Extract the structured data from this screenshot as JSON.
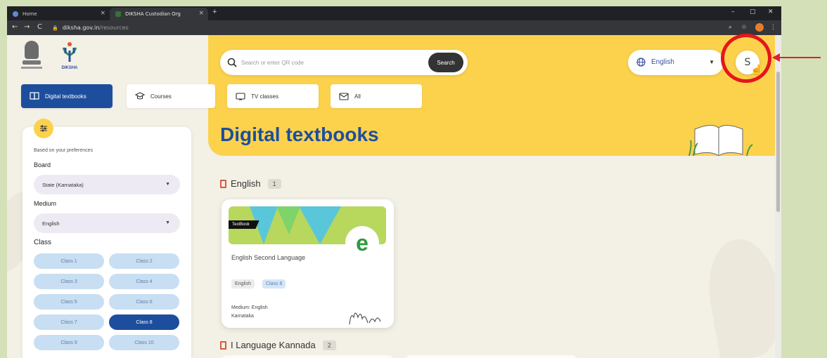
{
  "browser": {
    "tabs": [
      {
        "title": "Home"
      },
      {
        "title": "DIKSHA Custodian Org"
      }
    ],
    "new_tab": "+",
    "window_controls": {
      "minimize": "–",
      "maximize": "▢",
      "close": "✕"
    },
    "nav": {
      "back": "←",
      "forward": "→",
      "reload": "C"
    },
    "url": {
      "domain": "diksha.gov.in",
      "path": "/resources"
    }
  },
  "header": {
    "logo_text": "DIKSHA",
    "search": {
      "placeholder": "Search or enter QR code",
      "button_label": "Search"
    },
    "language": {
      "selected": "English"
    },
    "avatar_initial": "S"
  },
  "nav_tabs": [
    {
      "label": "Digital textbooks",
      "active": true
    },
    {
      "label": "Courses",
      "active": false
    },
    {
      "label": "TV classes",
      "active": false
    },
    {
      "label": "All",
      "active": false
    }
  ],
  "hero": {
    "title": "Digital textbooks"
  },
  "filters": {
    "preference_note": "Based on your preferences",
    "board": {
      "label": "Board",
      "value": "State (Karnataka)"
    },
    "medium": {
      "label": "Medium",
      "value": "English"
    },
    "class": {
      "label": "Class",
      "options": [
        "Class 1",
        "Class 2",
        "Class 3",
        "Class 4",
        "Class 5",
        "Class 6",
        "Class 7",
        "Class 8",
        "Class 9",
        "Class 10"
      ],
      "selected": "Class 8"
    }
  },
  "sections": [
    {
      "title": "English",
      "count": "1",
      "cards": [
        {
          "badge": "TextBook",
          "title": "English Second Language",
          "chips": [
            "English",
            "Class 8"
          ],
          "medium": "Medium: English",
          "board": "Karnataka"
        }
      ]
    },
    {
      "title": "I Language Kannada",
      "count": "2"
    }
  ],
  "colors": {
    "brand_blue": "#1d4e9d",
    "hero_yellow": "#fcd24d",
    "annotation_red": "#e5161c",
    "chip_blue": "#c8def2"
  }
}
